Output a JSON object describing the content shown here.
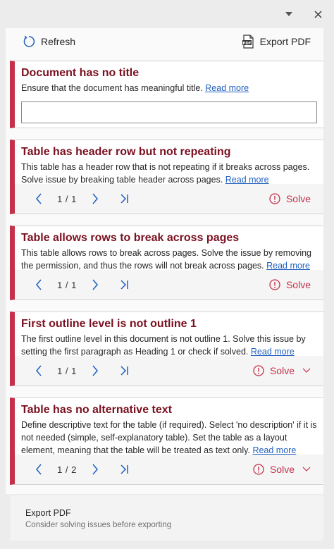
{
  "window": {
    "dropdown_icon": "caret-down-icon",
    "close_icon": "close-icon"
  },
  "toolbar": {
    "refresh_label": "Refresh",
    "export_label": "Export PDF"
  },
  "issues": [
    {
      "title": "Document has no title",
      "description": "Ensure that the document has meaningful title.",
      "link": "Read more",
      "input_value": ""
    },
    {
      "title": "Table has header row but not repeating",
      "description": "This table has a header row that is not repeating if it breaks across pages. Solve issue by breaking table header across pages.",
      "link": "Read more",
      "counter": "1 / 1",
      "solve_label": "Solve"
    },
    {
      "title": "Table allows rows to break across pages",
      "description": "This table allows rows to break across pages. Solve the issue by removing the permission, and thus the rows will not break across pages.",
      "link": "Read more",
      "counter": "1 / 1",
      "solve_label": "Solve"
    },
    {
      "title": "First outline level is not outline 1",
      "description": "The first outline level in this document is not outline 1. Solve this issue by setting the first paragraph as Heading 1 or check if solved.",
      "link": "Read more",
      "counter": "1 / 1",
      "solve_label": "Solve"
    },
    {
      "title": "Table has no alternative text",
      "description": "Define descriptive text for the table (if required). Select 'no description' if it is not needed (simple, self-explanatory table). Set the table as a layout element, meaning that the table will be treated as text only.",
      "link": "Read more",
      "counter": "1 / 2",
      "solve_label": "Solve"
    }
  ],
  "footer": {
    "title": "Export PDF",
    "subtitle": "Consider solving issues before exporting"
  },
  "colors": {
    "accent": "#c4314b",
    "title": "#7a1020",
    "link": "#1f5fbf",
    "nav": "#1f5fbf"
  }
}
